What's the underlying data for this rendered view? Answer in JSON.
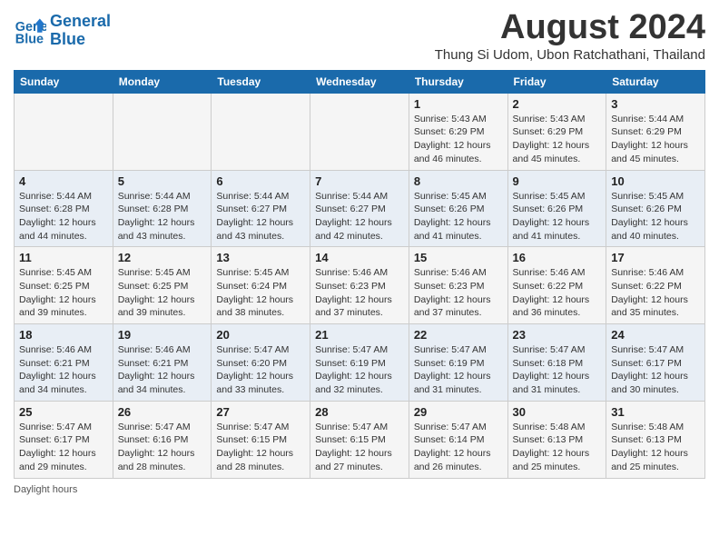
{
  "logo": {
    "line1": "General",
    "line2": "Blue"
  },
  "title": "August 2024",
  "subtitle": "Thung Si Udom, Ubon Ratchathani, Thailand",
  "headers": [
    "Sunday",
    "Monday",
    "Tuesday",
    "Wednesday",
    "Thursday",
    "Friday",
    "Saturday"
  ],
  "weeks": [
    [
      {
        "date": "",
        "info": ""
      },
      {
        "date": "",
        "info": ""
      },
      {
        "date": "",
        "info": ""
      },
      {
        "date": "",
        "info": ""
      },
      {
        "date": "1",
        "info": "Sunrise: 5:43 AM\nSunset: 6:29 PM\nDaylight: 12 hours\nand 46 minutes."
      },
      {
        "date": "2",
        "info": "Sunrise: 5:43 AM\nSunset: 6:29 PM\nDaylight: 12 hours\nand 45 minutes."
      },
      {
        "date": "3",
        "info": "Sunrise: 5:44 AM\nSunset: 6:29 PM\nDaylight: 12 hours\nand 45 minutes."
      }
    ],
    [
      {
        "date": "4",
        "info": "Sunrise: 5:44 AM\nSunset: 6:28 PM\nDaylight: 12 hours\nand 44 minutes."
      },
      {
        "date": "5",
        "info": "Sunrise: 5:44 AM\nSunset: 6:28 PM\nDaylight: 12 hours\nand 43 minutes."
      },
      {
        "date": "6",
        "info": "Sunrise: 5:44 AM\nSunset: 6:27 PM\nDaylight: 12 hours\nand 43 minutes."
      },
      {
        "date": "7",
        "info": "Sunrise: 5:44 AM\nSunset: 6:27 PM\nDaylight: 12 hours\nand 42 minutes."
      },
      {
        "date": "8",
        "info": "Sunrise: 5:45 AM\nSunset: 6:26 PM\nDaylight: 12 hours\nand 41 minutes."
      },
      {
        "date": "9",
        "info": "Sunrise: 5:45 AM\nSunset: 6:26 PM\nDaylight: 12 hours\nand 41 minutes."
      },
      {
        "date": "10",
        "info": "Sunrise: 5:45 AM\nSunset: 6:26 PM\nDaylight: 12 hours\nand 40 minutes."
      }
    ],
    [
      {
        "date": "11",
        "info": "Sunrise: 5:45 AM\nSunset: 6:25 PM\nDaylight: 12 hours\nand 39 minutes."
      },
      {
        "date": "12",
        "info": "Sunrise: 5:45 AM\nSunset: 6:25 PM\nDaylight: 12 hours\nand 39 minutes."
      },
      {
        "date": "13",
        "info": "Sunrise: 5:45 AM\nSunset: 6:24 PM\nDaylight: 12 hours\nand 38 minutes."
      },
      {
        "date": "14",
        "info": "Sunrise: 5:46 AM\nSunset: 6:23 PM\nDaylight: 12 hours\nand 37 minutes."
      },
      {
        "date": "15",
        "info": "Sunrise: 5:46 AM\nSunset: 6:23 PM\nDaylight: 12 hours\nand 37 minutes."
      },
      {
        "date": "16",
        "info": "Sunrise: 5:46 AM\nSunset: 6:22 PM\nDaylight: 12 hours\nand 36 minutes."
      },
      {
        "date": "17",
        "info": "Sunrise: 5:46 AM\nSunset: 6:22 PM\nDaylight: 12 hours\nand 35 minutes."
      }
    ],
    [
      {
        "date": "18",
        "info": "Sunrise: 5:46 AM\nSunset: 6:21 PM\nDaylight: 12 hours\nand 34 minutes."
      },
      {
        "date": "19",
        "info": "Sunrise: 5:46 AM\nSunset: 6:21 PM\nDaylight: 12 hours\nand 34 minutes."
      },
      {
        "date": "20",
        "info": "Sunrise: 5:47 AM\nSunset: 6:20 PM\nDaylight: 12 hours\nand 33 minutes."
      },
      {
        "date": "21",
        "info": "Sunrise: 5:47 AM\nSunset: 6:19 PM\nDaylight: 12 hours\nand 32 minutes."
      },
      {
        "date": "22",
        "info": "Sunrise: 5:47 AM\nSunset: 6:19 PM\nDaylight: 12 hours\nand 31 minutes."
      },
      {
        "date": "23",
        "info": "Sunrise: 5:47 AM\nSunset: 6:18 PM\nDaylight: 12 hours\nand 31 minutes."
      },
      {
        "date": "24",
        "info": "Sunrise: 5:47 AM\nSunset: 6:17 PM\nDaylight: 12 hours\nand 30 minutes."
      }
    ],
    [
      {
        "date": "25",
        "info": "Sunrise: 5:47 AM\nSunset: 6:17 PM\nDaylight: 12 hours\nand 29 minutes."
      },
      {
        "date": "26",
        "info": "Sunrise: 5:47 AM\nSunset: 6:16 PM\nDaylight: 12 hours\nand 28 minutes."
      },
      {
        "date": "27",
        "info": "Sunrise: 5:47 AM\nSunset: 6:15 PM\nDaylight: 12 hours\nand 28 minutes."
      },
      {
        "date": "28",
        "info": "Sunrise: 5:47 AM\nSunset: 6:15 PM\nDaylight: 12 hours\nand 27 minutes."
      },
      {
        "date": "29",
        "info": "Sunrise: 5:47 AM\nSunset: 6:14 PM\nDaylight: 12 hours\nand 26 minutes."
      },
      {
        "date": "30",
        "info": "Sunrise: 5:48 AM\nSunset: 6:13 PM\nDaylight: 12 hours\nand 25 minutes."
      },
      {
        "date": "31",
        "info": "Sunrise: 5:48 AM\nSunset: 6:13 PM\nDaylight: 12 hours\nand 25 minutes."
      }
    ]
  ],
  "footer": "Daylight hours"
}
